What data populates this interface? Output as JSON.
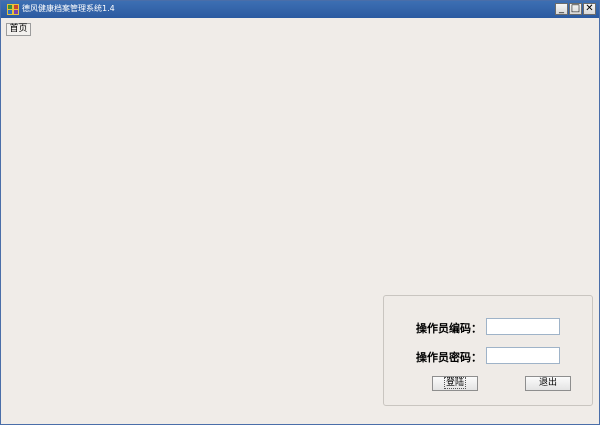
{
  "window": {
    "title": "德风健康档案管理系统1.4",
    "controls": {
      "minimize": "_",
      "maximize": "□",
      "close": "✕"
    }
  },
  "toolbar": {
    "home_label": "首页"
  },
  "login": {
    "operator_code_label": "操作员编码：",
    "operator_code_value": "",
    "operator_password_label": "操作员密码：",
    "operator_password_value": "",
    "login_button": "登陆",
    "exit_button": "退出"
  }
}
